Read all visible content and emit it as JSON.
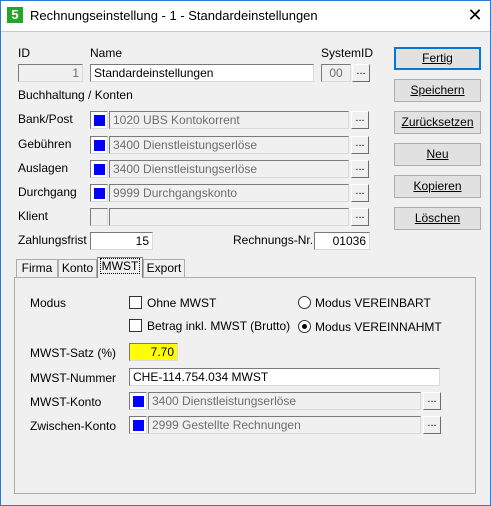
{
  "window": {
    "icon_char": "5",
    "title": "Rechnungseinstellung - 1 -  Standardeinstellungen",
    "close": "✕"
  },
  "header": {
    "id_label": "ID",
    "id_value": "1",
    "name_label": "Name",
    "name_value": "Standardeinstellungen",
    "systemid_label": "SystemID",
    "systemid_value": "00"
  },
  "accounting": {
    "section_label": "Buchhaltung / Konten",
    "rows": [
      {
        "label": "Bank/Post",
        "value": "1020 UBS Kontokorrent"
      },
      {
        "label": "Gebühren",
        "value": "3400 Dienstleistungserlöse"
      },
      {
        "label": "Auslagen",
        "value": "3400 Dienstleistungserlöse"
      },
      {
        "label": "Durchgang",
        "value": "9999 Durchgangskonto"
      },
      {
        "label": "Klient",
        "value": ""
      }
    ],
    "dots": "..."
  },
  "payment": {
    "label": "Zahlungsfrist",
    "value": "15",
    "invoice_no_label": "Rechnungs-Nr.",
    "invoice_no_value": "01036"
  },
  "buttons": {
    "done": "Fertig",
    "save": "Speichern",
    "reset": "Zurücksetzen",
    "new": "Neu",
    "copy": "Kopieren",
    "delete": "Löschen"
  },
  "tabs": [
    "Firma",
    "Konto",
    "MWST",
    "Export"
  ],
  "active_tab": "MWST",
  "mwst": {
    "mode_label": "Modus",
    "without_vat_label": "Ohne MWST",
    "amount_incl_label": "Betrag inkl. MWST (Brutto)",
    "mode_agreed_label": "Modus VEREINBART",
    "mode_received_label": "Modus VEREINNAHMT",
    "selected_mode": "VEREINNAHMT",
    "rate_label": "MWST-Satz (%)",
    "rate_value": "7.70",
    "number_label": "MWST-Nummer",
    "number_value": "CHE-114.754.034 MWST",
    "account_label": "MWST-Konto",
    "account_value": "3400 Dienstleistungserlöse",
    "interim_label": "Zwischen-Konto",
    "interim_value": "2999 Gestellte Rechnungen"
  },
  "colors": {
    "account_swatch": "#0000ff",
    "rate_highlight": "#ffff00",
    "app_icon": "#29a329"
  }
}
